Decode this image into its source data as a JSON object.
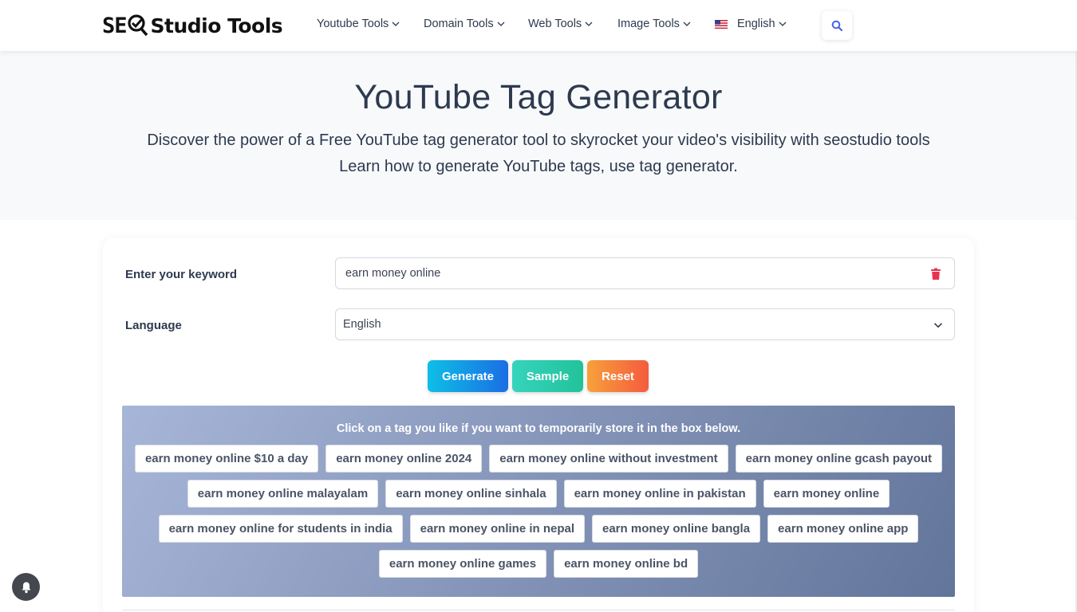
{
  "brand": {
    "logo_text_seo": "SE",
    "logo_text_rest": "Studio Tools"
  },
  "nav": {
    "items": [
      {
        "label": "Youtube Tools"
      },
      {
        "label": "Domain Tools"
      },
      {
        "label": "Web Tools"
      },
      {
        "label": "Image Tools"
      }
    ],
    "language": "English"
  },
  "hero": {
    "title": "YouTube Tag Generator",
    "line1": "Discover the power of a Free YouTube tag generator tool to skyrocket your video's visibility with seostudio tools",
    "line2": "Learn how to generate YouTube tags, use tag generator."
  },
  "form": {
    "keyword_label": "Enter your keyword",
    "keyword_value": "earn money online",
    "language_label": "Language",
    "language_value": "English",
    "generate_label": "Generate",
    "sample_label": "Sample",
    "reset_label": "Reset"
  },
  "tags": {
    "hint": "Click on a tag you like if you want to temporarily store it in the box below.",
    "rows": [
      [
        "earn money online $10 a day",
        "earn money online 2024",
        "earn money online without investment",
        "earn money online gcash payout"
      ],
      [
        "earn money online malayalam",
        "earn money online sinhala",
        "earn money online in pakistan",
        "earn money online"
      ],
      [
        "earn money online for students in india",
        "earn money online in nepal",
        "earn money online bangla",
        "earn money online app"
      ],
      [
        "earn money online games",
        "earn money online bd"
      ]
    ]
  },
  "colors": {
    "text": "#2d3a4f",
    "generate": "#1b6ee4",
    "sample": "#22c29a",
    "reset": "#f55b3e",
    "trash": "#e8344e",
    "search_icon": "#4a63e7"
  }
}
